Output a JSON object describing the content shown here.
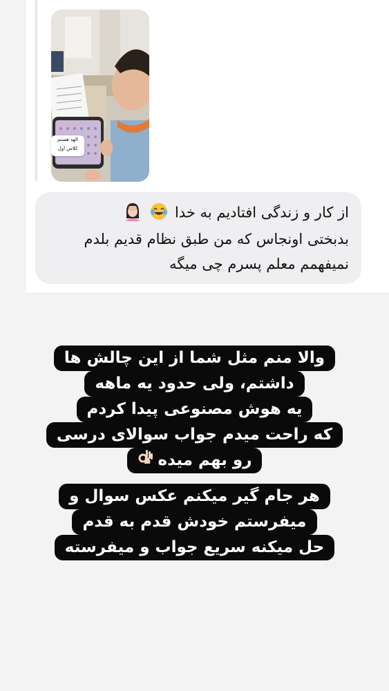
{
  "reply": {
    "thumbnail_sticker_lines": [
      "الهه هستم",
      "کلاس اول"
    ],
    "message_lines": [
      "از کار و زندگی افتادیم به خدا",
      "بدبختی اونجاس که من طبق نظام قدیم بلدم",
      "نمیفهمم معلم پسرم چی میگه"
    ],
    "message_emojis": [
      "face-with-tears-of-joy-icon",
      "woman-facepalming-icon"
    ]
  },
  "story": {
    "paragraph1": [
      "والا منم مثل شما از این چالش ها",
      "داشتم، ولی حدود یه ماهه",
      "یه هوش مصنوعی پیدا کردم",
      "که راحت میدم جواب سوالای درسی",
      "رو بهم میده"
    ],
    "paragraph1_emoji": "ok-hand-icon",
    "paragraph2": [
      "هر جام گیر میکنم عکس سوال و",
      "میفرستم خودش قدم به قدم",
      "حل میکنه سریع جواب و میفرسته"
    ]
  },
  "colors": {
    "page_background": "#f3f3f4",
    "bubble": "#efeff1",
    "story_highlight": "#0a0a0a",
    "story_text": "#ffffff"
  }
}
